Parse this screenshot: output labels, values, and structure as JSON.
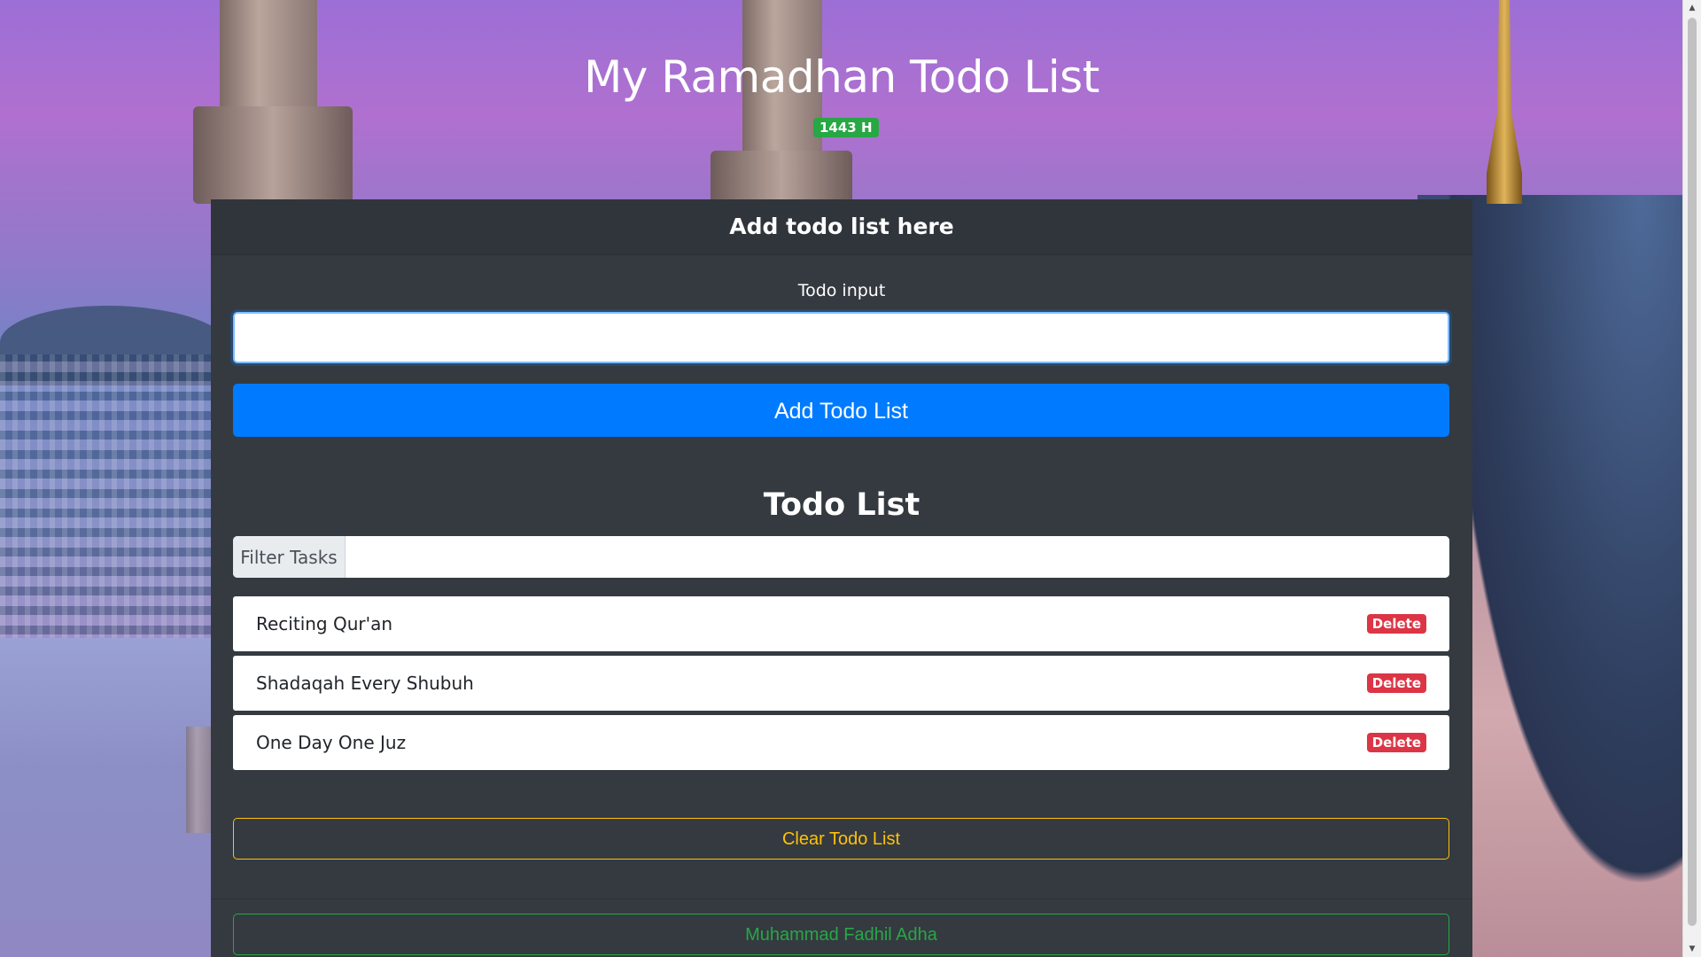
{
  "header": {
    "title": "My Ramadhan Todo List",
    "year_badge": "1443 H"
  },
  "form": {
    "card_title": "Add todo list here",
    "input_label": "Todo input",
    "input_value": "",
    "input_placeholder": "",
    "add_button_label": "Add Todo List"
  },
  "list": {
    "title": "Todo List",
    "filter_label": "Filter Tasks",
    "filter_value": "",
    "delete_label": "Delete",
    "items": [
      {
        "text": "Reciting Qur'an"
      },
      {
        "text": "Shadaqah Every Shubuh"
      },
      {
        "text": "One Day One Juz"
      }
    ],
    "clear_button_label": "Clear Todo List"
  },
  "footer": {
    "author": "Muhammad Fadhil Adha"
  },
  "colors": {
    "primary": "#007bff",
    "success": "#28a745",
    "danger": "#dc3545",
    "warning": "#ffc107",
    "card_bg": "#343a40"
  },
  "icons": {
    "scroll_up": "triangle-up-icon",
    "scroll_down": "triangle-down-icon"
  }
}
